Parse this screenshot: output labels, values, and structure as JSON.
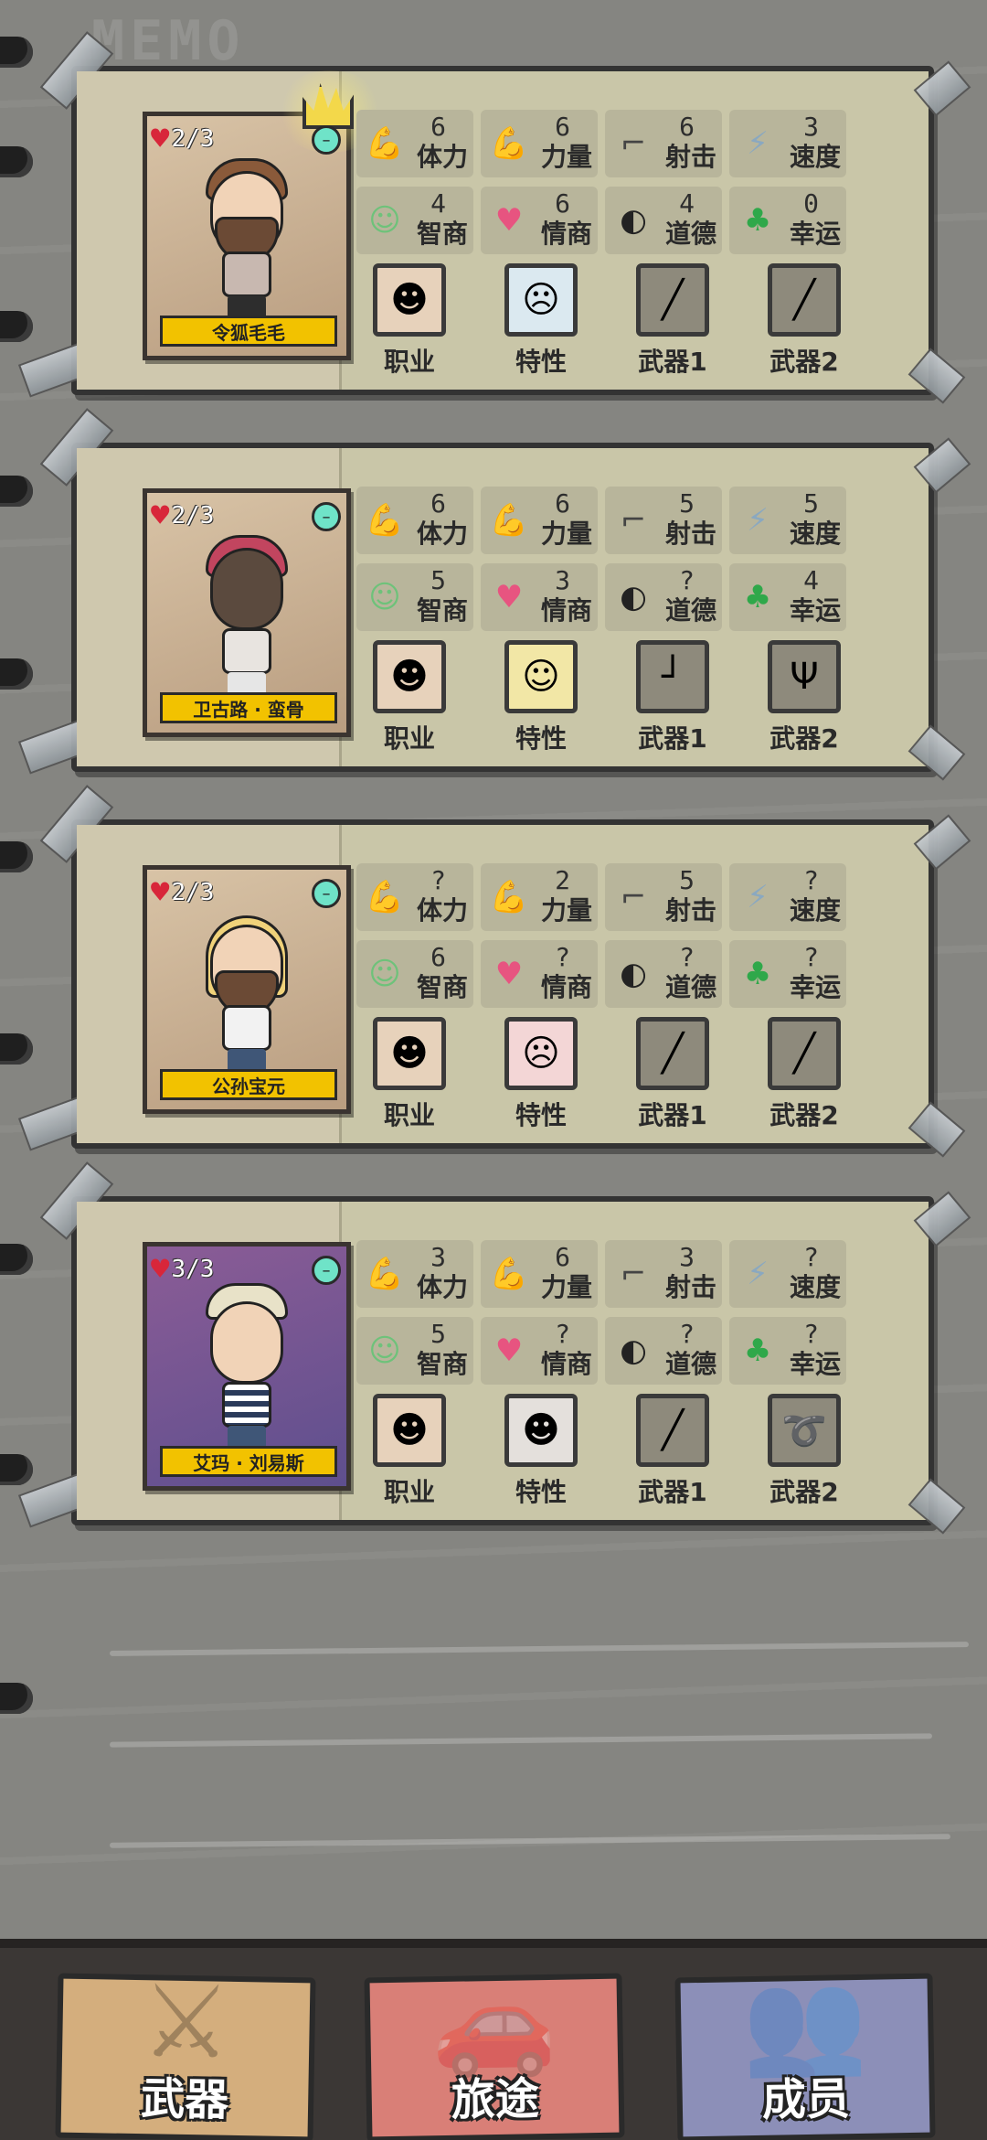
{
  "watermark": "MEMO",
  "stat_labels": {
    "stamina": "体力",
    "strength": "力量",
    "shooting": "射击",
    "speed": "速度",
    "intelligence": "智商",
    "emotional": "情商",
    "morality": "道德",
    "luck": "幸运"
  },
  "slot_labels": {
    "job": "职业",
    "trait": "特性",
    "weapon1": "武器1",
    "weapon2": "武器2"
  },
  "members": [
    {
      "name": "令狐毛毛",
      "hp": "2/3",
      "leader": true,
      "stats": {
        "stamina": "6",
        "strength": "6",
        "shooting": "6",
        "speed": "3",
        "intelligence": "4",
        "emotional": "6",
        "morality": "4",
        "luck": "0"
      }
    },
    {
      "name": "卫古路 · 蛮骨",
      "hp": "2/3",
      "leader": false,
      "stats": {
        "stamina": "6",
        "strength": "6",
        "shooting": "5",
        "speed": "5",
        "intelligence": "5",
        "emotional": "3",
        "morality": "?",
        "luck": "4"
      }
    },
    {
      "name": "公孙宝元",
      "hp": "2/3",
      "leader": false,
      "stats": {
        "stamina": "?",
        "strength": "2",
        "shooting": "5",
        "speed": "?",
        "intelligence": "6",
        "emotional": "?",
        "morality": "?",
        "luck": "?"
      }
    },
    {
      "name": "艾玛 · 刘易斯",
      "hp": "3/3",
      "leader": false,
      "stats": {
        "stamina": "3",
        "strength": "6",
        "shooting": "3",
        "speed": "?",
        "intelligence": "5",
        "emotional": "?",
        "morality": "?",
        "luck": "?"
      }
    }
  ],
  "nav": {
    "weapons": "武器",
    "journey": "旅途",
    "members": "成员"
  },
  "colors": {
    "card_bg": "#c9c6a8",
    "nameplate": "#f2c200",
    "heart": "#d8263a",
    "mood": "#6fe3c8"
  },
  "icons": {
    "stamina": "muscle-arms-icon",
    "strength": "flexed-arm-icon",
    "shooting": "pistol-icon",
    "speed": "winged-boot-icon",
    "intelligence": "brain-icon",
    "emotional": "heart-head-icon",
    "morality": "half-mask-icon",
    "luck": "four-leaf-clover-icon"
  }
}
